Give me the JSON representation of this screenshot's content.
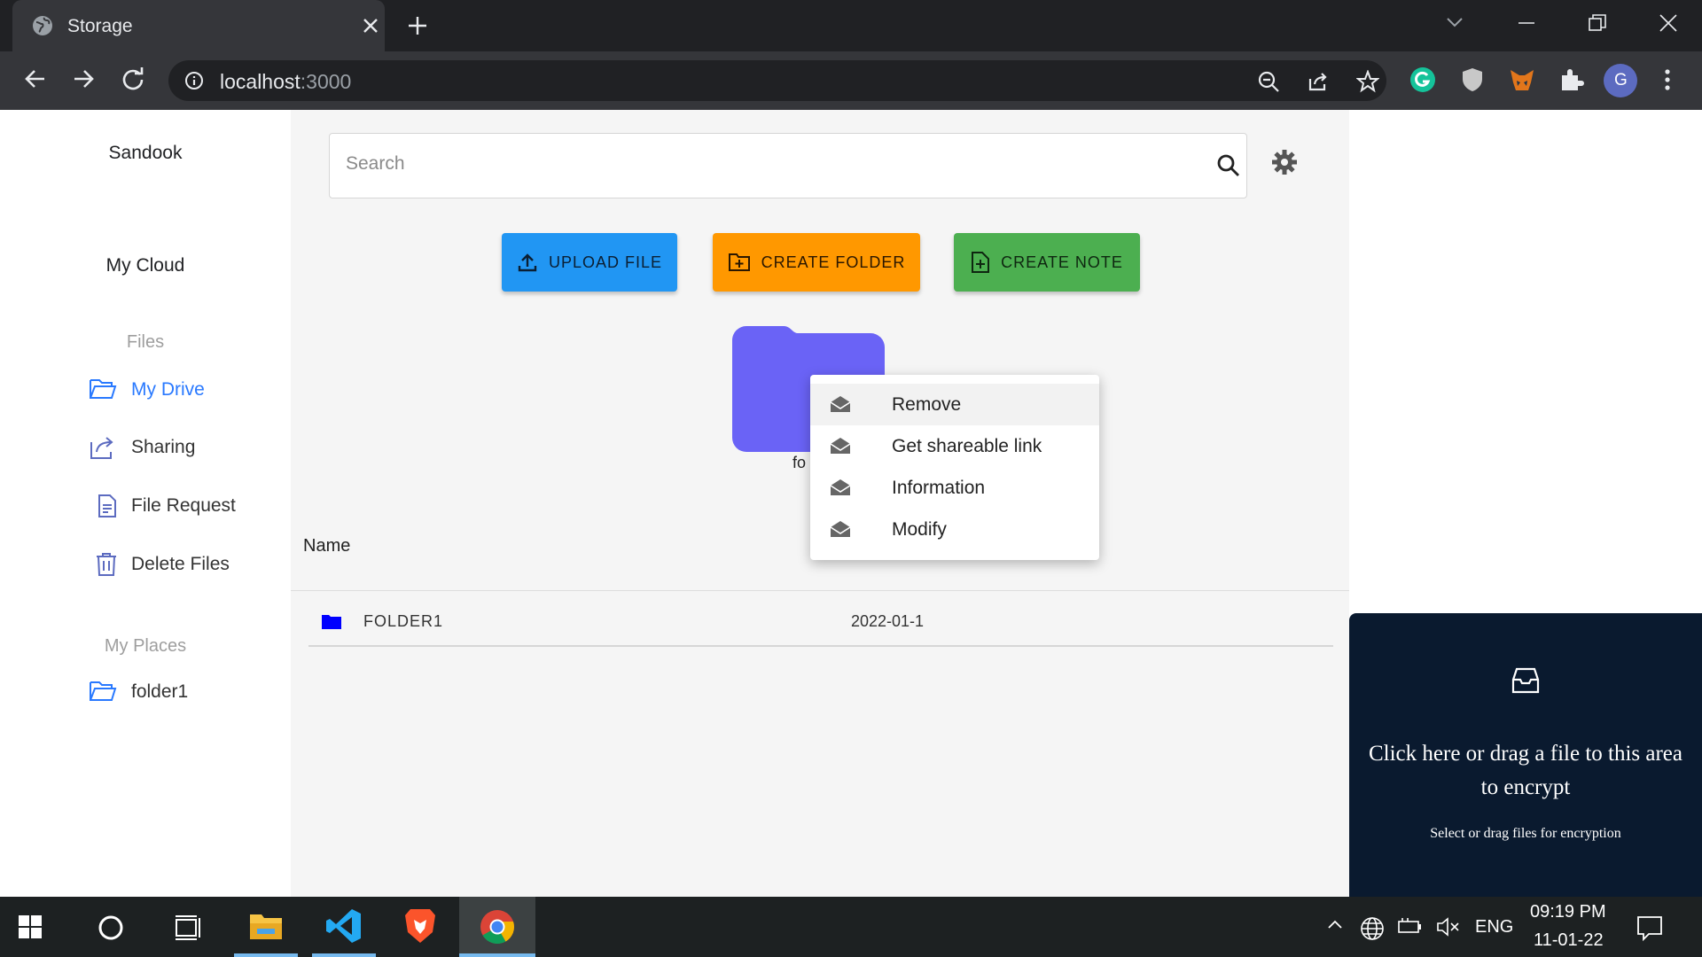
{
  "browser": {
    "tab_title": "Storage",
    "url_host": "localhost",
    "url_port": ":3000",
    "profile_initial": "G"
  },
  "sidebar": {
    "brand": "Sandook",
    "section_title": "My Cloud",
    "files_label": "Files",
    "items": [
      {
        "label": "My Drive",
        "icon": "folder-open-icon",
        "active": true
      },
      {
        "label": "Sharing",
        "icon": "share-icon",
        "active": false
      },
      {
        "label": "File Request",
        "icon": "document-icon",
        "active": false
      },
      {
        "label": "Delete Files",
        "icon": "trash-icon",
        "active": false
      }
    ],
    "places_label": "My Places",
    "places": [
      {
        "label": "folder1",
        "icon": "folder-open-icon"
      }
    ]
  },
  "search": {
    "placeholder": "Search"
  },
  "actions": {
    "upload": "UPLOAD FILE",
    "create_folder": "CREATE FOLDER",
    "create_note": "CREATE NOTE"
  },
  "colors": {
    "upload": "#2196f3",
    "create_folder": "#ff9800",
    "create_note": "#4caf50",
    "accent": "#2979ff",
    "folder_tile": "#6a63f6",
    "dropzone_bg": "#0a1a2f"
  },
  "folder_tile": {
    "label_visible": "fo"
  },
  "table": {
    "header_name": "Name",
    "rows": [
      {
        "name": "FOLDER1",
        "date": "2022-01-1",
        "icon": "folder-icon"
      }
    ]
  },
  "context_menu": {
    "items": [
      "Remove",
      "Get shareable link",
      "Information",
      "Modify"
    ]
  },
  "dropzone": {
    "title": "Click here or drag a file to this area to encrypt",
    "subtitle": "Select or drag files for encryption"
  },
  "taskbar": {
    "language": "ENG",
    "time": "09:19 PM",
    "date": "11-01-22"
  }
}
